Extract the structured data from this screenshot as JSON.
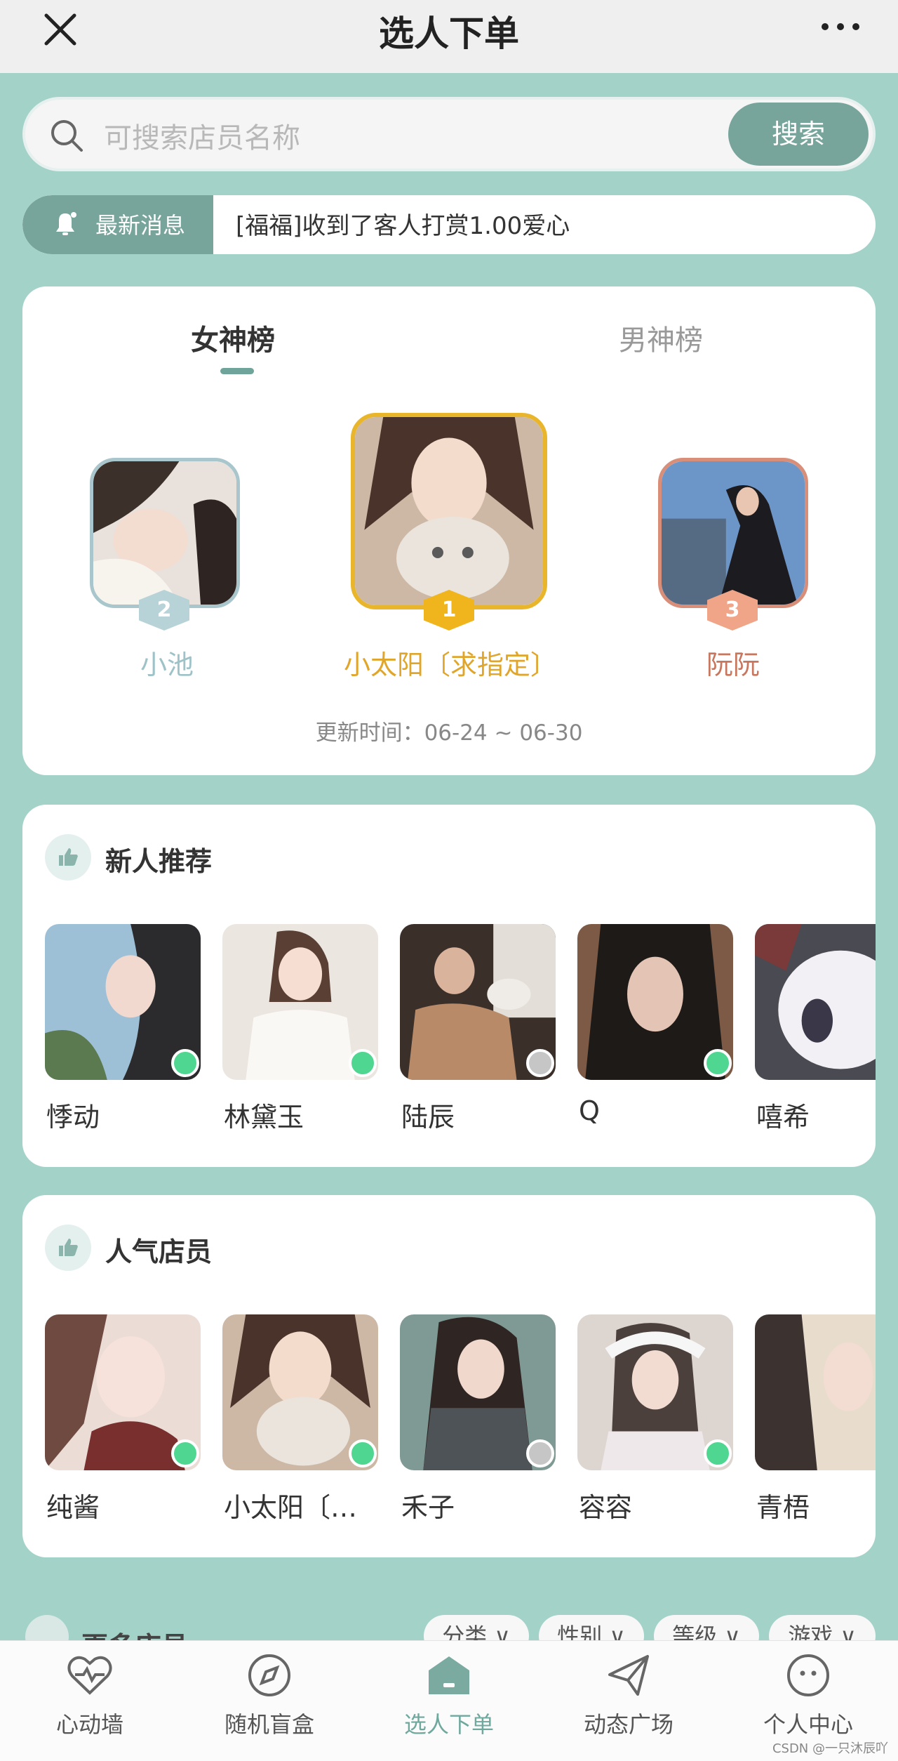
{
  "header": {
    "title": "选人下单"
  },
  "search": {
    "placeholder": "可搜索店员名称",
    "button_label": "搜索"
  },
  "news": {
    "tag": "最新消息",
    "text": "[福福]收到了客人打赏1.00爱心"
  },
  "ranking": {
    "tabs": [
      {
        "label": "女神榜",
        "active": true
      },
      {
        "label": "男神榜",
        "active": false
      }
    ],
    "podium": [
      {
        "rank": "2",
        "name": "小池"
      },
      {
        "rank": "1",
        "name": "小太阳〔求指定〕"
      },
      {
        "rank": "3",
        "name": "阮阮"
      }
    ],
    "update_time": "更新时间：06-24 ~ 06-30"
  },
  "newbies": {
    "title": "新人推荐",
    "people": [
      {
        "name": "悸动",
        "status": "online"
      },
      {
        "name": "林黛玉",
        "status": "online"
      },
      {
        "name": "陆辰",
        "status": "offline"
      },
      {
        "name": "Q",
        "status": "online"
      },
      {
        "name": "嘻希",
        "status": "none"
      }
    ]
  },
  "popular": {
    "title": "人气店员",
    "people": [
      {
        "name": "纯酱",
        "status": "online"
      },
      {
        "name": "小太阳〔…",
        "status": "online"
      },
      {
        "name": "禾子",
        "status": "offline"
      },
      {
        "name": "容容",
        "status": "online"
      },
      {
        "name": "青梧",
        "status": "none"
      }
    ]
  },
  "more": {
    "title": "更多店员",
    "filters": [
      "分类",
      "性别",
      "等级",
      "游戏"
    ]
  },
  "bottom_nav": [
    {
      "label": "心动墙",
      "icon": "heart-pulse-icon",
      "active": false
    },
    {
      "label": "随机盲盒",
      "icon": "compass-icon",
      "active": false
    },
    {
      "label": "选人下单",
      "icon": "house-icon",
      "active": true
    },
    {
      "label": "动态广场",
      "icon": "paper-plane-icon",
      "active": false
    },
    {
      "label": "个人中心",
      "icon": "smiley-icon",
      "active": false
    }
  ],
  "watermark": "CSDN @一只沐辰吖",
  "colors": {
    "accent": "#78a59b",
    "background": "#a3d2c8",
    "gold": "#e0a52b",
    "online": "#4fd690"
  }
}
